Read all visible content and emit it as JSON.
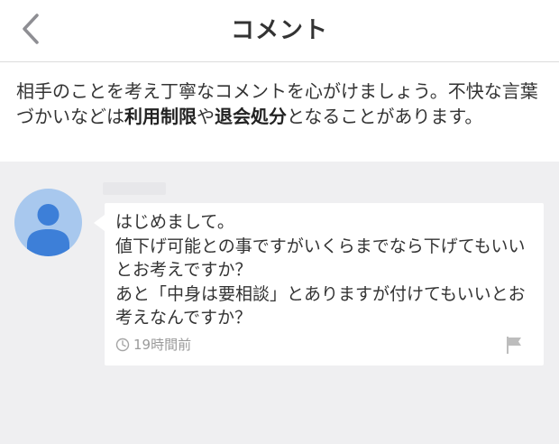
{
  "header": {
    "title": "コメント",
    "back_icon": "chevron-left-icon"
  },
  "notice": {
    "part1": "相手のことを考え丁寧なコメントを心がけましょう。不快な言葉づかいなどは",
    "bold1": "利用制限",
    "part2": "や",
    "bold2": "退会処分",
    "part3": "となることがあります。"
  },
  "comment": {
    "avatar_icon": "user-avatar-icon",
    "text": "はじめまして。\n値下げ可能との事ですがいくらまでなら下げてもいいとお考えですか？\nあと「中身は要相談」とありますが付けてもいいとお考えなんですか？",
    "time_icon": "clock-icon",
    "time": "19時間前",
    "report_icon": "flag-icon"
  },
  "colors": {
    "background": "#efeff1",
    "avatar_bg": "#a8c8ee",
    "avatar_fg": "#3d7fd8",
    "meta_text": "#9a9a9a"
  }
}
